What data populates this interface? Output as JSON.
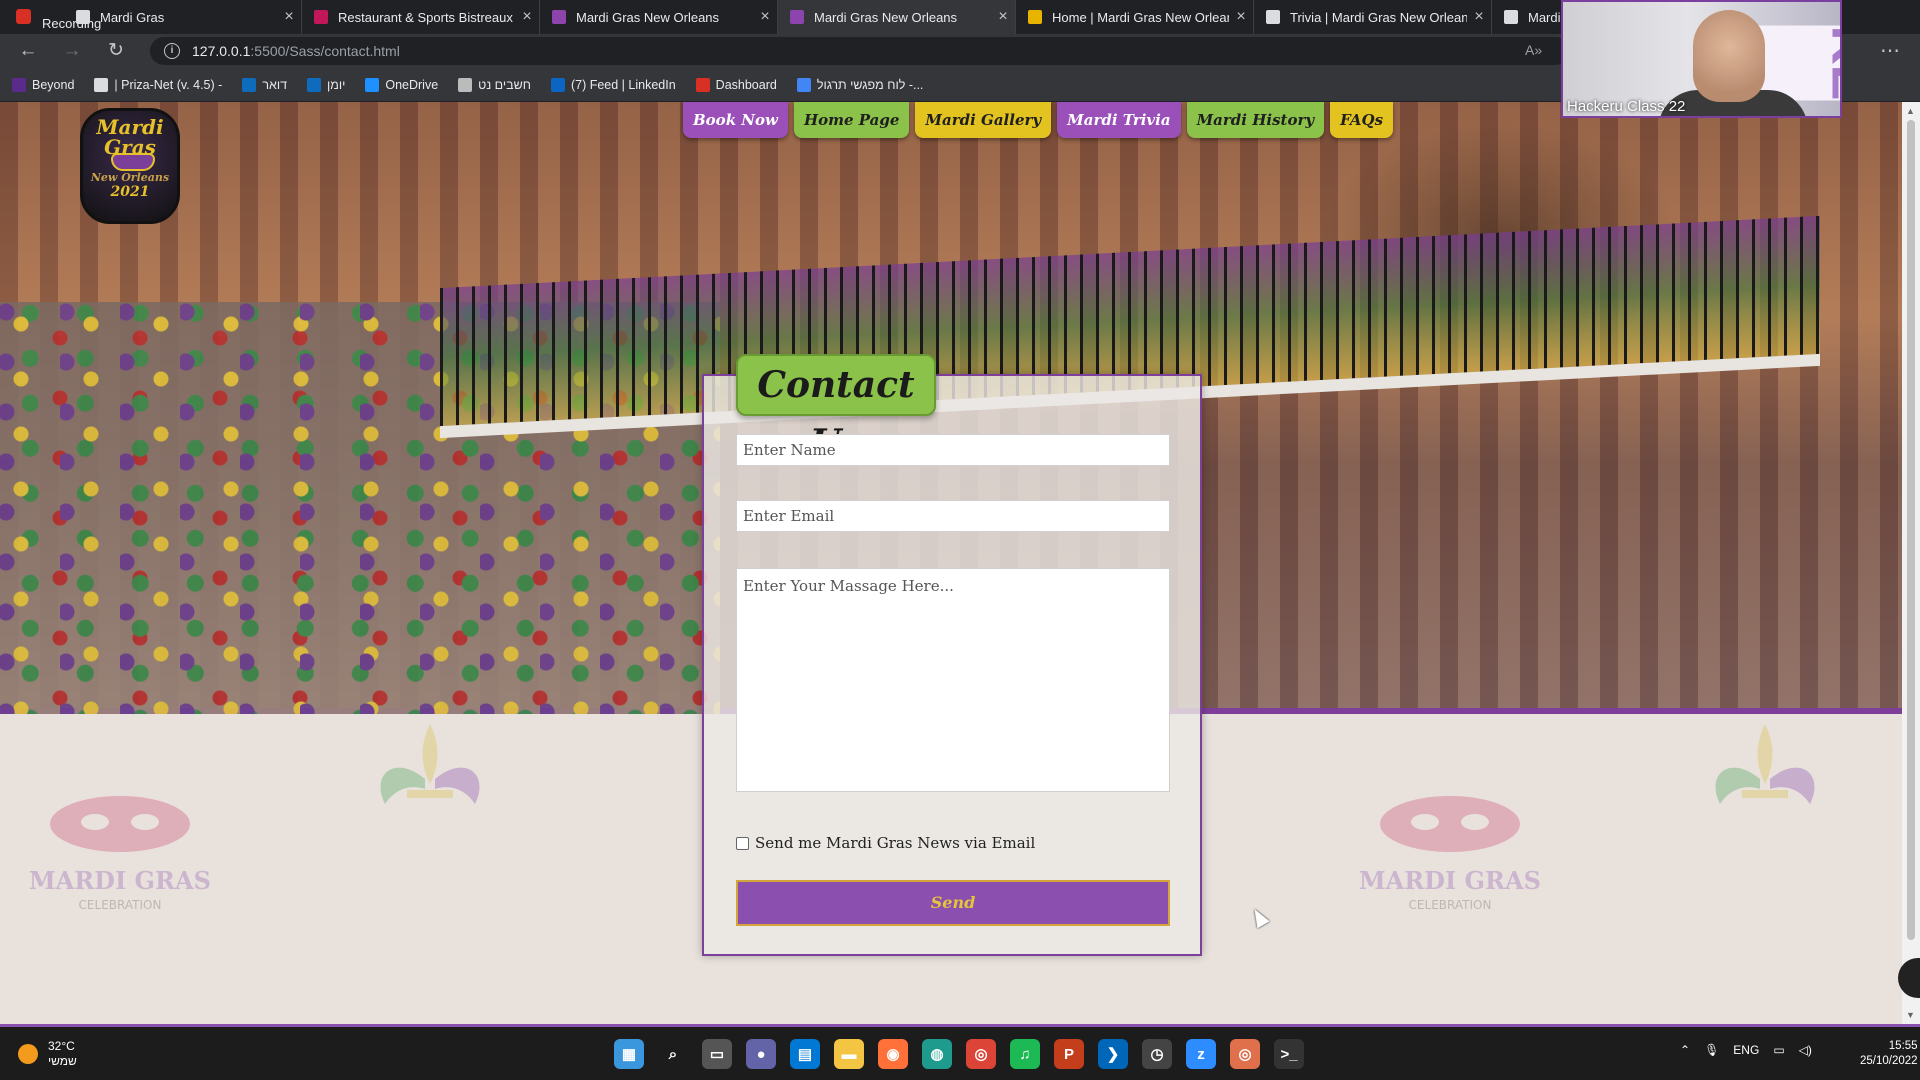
{
  "recording": {
    "label": "Recording"
  },
  "tabs": [
    {
      "title": "Mardi Gras",
      "color": "#dadce0",
      "active": false
    },
    {
      "title": "Restaurant & Sports Bistreaux | \\",
      "color": "#c2185b",
      "active": false
    },
    {
      "title": "Mardi Gras New Orleans",
      "color": "#8e44ad",
      "active": false
    },
    {
      "title": "Mardi Gras New Orleans",
      "color": "#8e44ad",
      "active": true
    },
    {
      "title": "Home | Mardi Gras New Orleans",
      "color": "#e8b400",
      "active": false
    },
    {
      "title": "Trivia | Mardi Gras New Orleans",
      "color": "#dadce0",
      "active": false
    },
    {
      "title": "Mardi Gras",
      "color": "#dadce0",
      "active": false
    }
  ],
  "address": {
    "host": "127.0.0.1",
    "path": ":5500/Sass/contact.html"
  },
  "bookmarks": [
    {
      "label": "Beyond",
      "color": "#5b2b8c"
    },
    {
      "label": "| Priza-Net (v. 4.5) -",
      "color": "#dadce0"
    },
    {
      "label": "דואר",
      "color": "#0f6cbd"
    },
    {
      "label": "יומן",
      "color": "#0f6cbd"
    },
    {
      "label": "OneDrive",
      "color": "#1e90ff"
    },
    {
      "label": "חשבים נט",
      "color": "#bbbbbb"
    },
    {
      "label": "(7) Feed | LinkedIn",
      "color": "#0a66c2"
    },
    {
      "label": "Dashboard",
      "color": "#d93025"
    },
    {
      "label": "לוח מפגשי תרגול -...",
      "color": "#4285f4"
    }
  ],
  "webcam": {
    "label": "Hackeru Class 22",
    "banner": "KER"
  },
  "logo": {
    "line1": "Mardi",
    "line2": "Gras",
    "line3": "New Orleans",
    "line4": "2021"
  },
  "site_nav": [
    {
      "label": "Book Now",
      "style": "purple"
    },
    {
      "label": "Home Page",
      "style": "green"
    },
    {
      "label": "Mardi Gallery",
      "style": "yellow"
    },
    {
      "label": "Mardi Trivia",
      "style": "purple"
    },
    {
      "label": "Mardi History",
      "style": "green"
    },
    {
      "label": "FAQs",
      "style": "yellow"
    }
  ],
  "contact": {
    "title": "Contact Us",
    "name_placeholder": "Enter Name",
    "email_placeholder": "Enter Email",
    "message_placeholder": "Enter Your Massage Here...",
    "newsletter_label": "Send me Mardi Gras News via Email",
    "send_label": "Send"
  },
  "deco": {
    "celebration_text": "MARDI GRAS",
    "celebration_sub": "CELEBRATION"
  },
  "taskbar": {
    "temperature": "32°C",
    "weather_desc": "שמשי",
    "language": "ENG",
    "time": "15:55",
    "date": "25/10/2022",
    "apps": [
      {
        "name": "windows-start",
        "glyph": "▦",
        "color": "#3a96dd"
      },
      {
        "name": "search",
        "glyph": "⌕",
        "color": "transparent"
      },
      {
        "name": "task-view",
        "glyph": "▭",
        "color": "#555"
      },
      {
        "name": "teams-chat",
        "glyph": "●",
        "color": "#6264a7"
      },
      {
        "name": "store",
        "glyph": "▤",
        "color": "#0078d4"
      },
      {
        "name": "file-explorer",
        "glyph": "▬",
        "color": "#f4c542"
      },
      {
        "name": "firefox",
        "glyph": "◉",
        "color": "#ff7139"
      },
      {
        "name": "edge",
        "glyph": "◍",
        "color": "#1f9b8e"
      },
      {
        "name": "chrome",
        "glyph": "◎",
        "color": "#db4437"
      },
      {
        "name": "spotify",
        "glyph": "♫",
        "color": "#1db954"
      },
      {
        "name": "powerpoint",
        "glyph": "P",
        "color": "#c43e1c"
      },
      {
        "name": "vscode",
        "glyph": "❯",
        "color": "#0066b8"
      },
      {
        "name": "clock",
        "glyph": "◷",
        "color": "#444"
      },
      {
        "name": "zoom",
        "glyph": "z",
        "color": "#2d8cff"
      },
      {
        "name": "chrome-profile",
        "glyph": "◎",
        "color": "#e0704c"
      },
      {
        "name": "terminal",
        "glyph": ">_",
        "color": "#333"
      }
    ]
  }
}
